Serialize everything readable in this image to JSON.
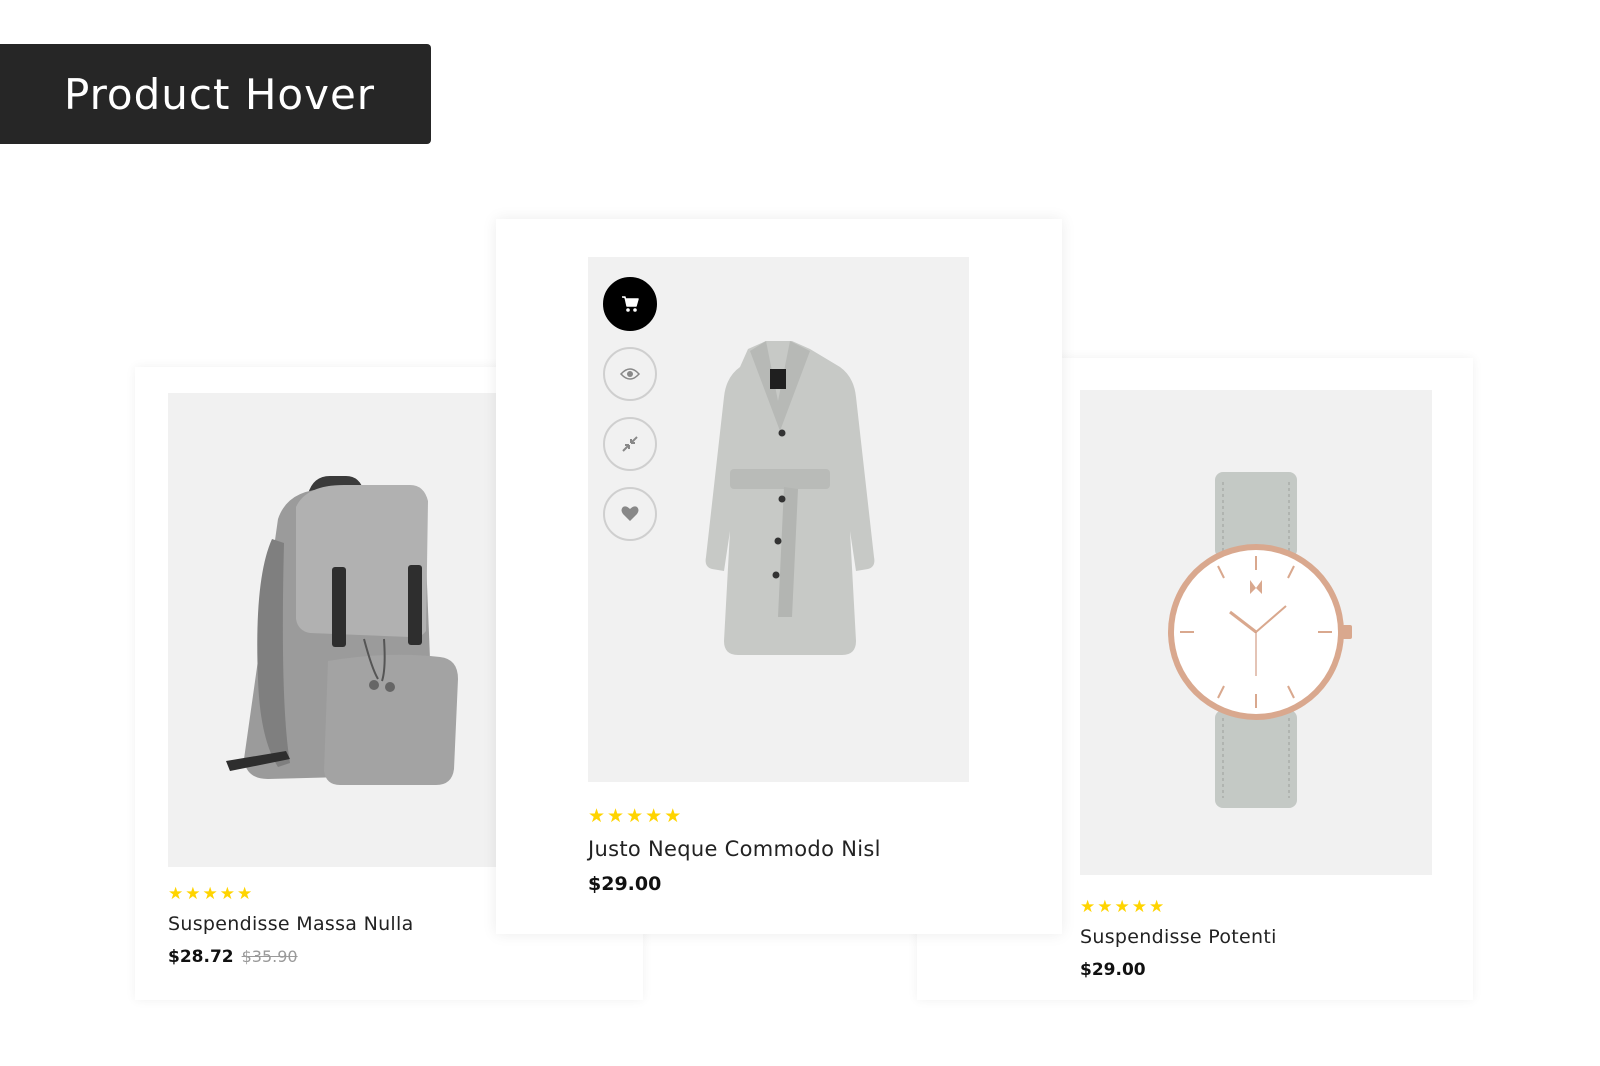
{
  "banner": {
    "title": "Product Hover"
  },
  "products": [
    {
      "title": "Suspendisse Massa Nulla",
      "price": "$28.72",
      "old_price": "$35.90",
      "rating": 5,
      "image": "gray-backpack"
    },
    {
      "title": "Justo Neque Commodo Nisl",
      "price": "$29.00",
      "rating": 5,
      "image": "gray-trench-coat",
      "actions": [
        "cart-icon",
        "eye-icon",
        "compare-icon",
        "heart-icon"
      ]
    },
    {
      "title": "Suspendisse Potenti",
      "price": "$29.00",
      "rating": 5,
      "image": "rose-gold-watch"
    }
  ],
  "colors": {
    "banner_bg": "#262626",
    "star": "#ffd400",
    "image_bg": "#f1f1f1"
  }
}
